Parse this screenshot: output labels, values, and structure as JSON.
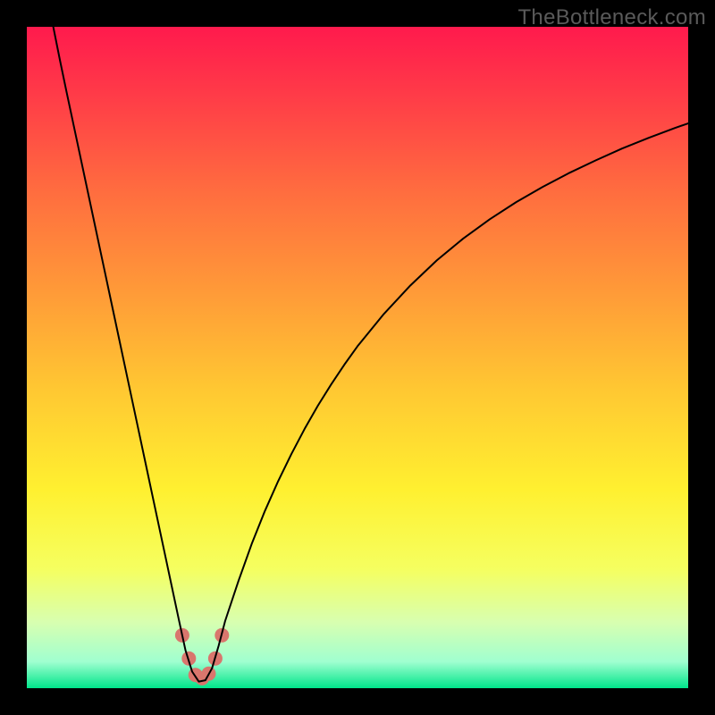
{
  "watermark_text": "TheBottleneck.com",
  "chart_data": {
    "type": "line",
    "title": "",
    "xlabel": "",
    "ylabel": "",
    "xlim": [
      0,
      100
    ],
    "ylim": [
      0,
      100
    ],
    "grid": false,
    "legend": false,
    "background_gradient_stops": [
      {
        "offset": 0.0,
        "color": "#ff1a4d"
      },
      {
        "offset": 0.1,
        "color": "#ff3a48"
      },
      {
        "offset": 0.25,
        "color": "#ff6d3f"
      },
      {
        "offset": 0.4,
        "color": "#ff9a38"
      },
      {
        "offset": 0.55,
        "color": "#ffc832"
      },
      {
        "offset": 0.7,
        "color": "#fff030"
      },
      {
        "offset": 0.82,
        "color": "#f5ff60"
      },
      {
        "offset": 0.9,
        "color": "#d8ffb0"
      },
      {
        "offset": 0.96,
        "color": "#a0ffd0"
      },
      {
        "offset": 1.0,
        "color": "#00e58a"
      }
    ],
    "series": [
      {
        "name": "bottleneck-curve",
        "color": "#000000",
        "stroke_width": 2.0,
        "x": [
          4.0,
          5.0,
          6.0,
          7.0,
          8.0,
          9.0,
          10.0,
          11.0,
          12.0,
          13.0,
          14.0,
          15.0,
          16.0,
          17.0,
          18.0,
          19.0,
          20.0,
          21.0,
          22.0,
          23.0,
          24.0,
          25.0,
          26.0,
          27.0,
          28.0,
          29.0,
          30.0,
          32.0,
          34.0,
          36.0,
          38.0,
          40.0,
          42.0,
          44.0,
          46.0,
          48.0,
          50.0,
          54.0,
          58.0,
          62.0,
          66.0,
          70.0,
          74.0,
          78.0,
          82.0,
          86.0,
          90.0,
          94.0,
          98.0,
          100.0
        ],
        "y": [
          100.0,
          95.0,
          90.2,
          85.5,
          80.8,
          76.1,
          71.4,
          66.7,
          62.0,
          57.3,
          52.6,
          47.9,
          43.2,
          38.5,
          33.8,
          29.1,
          24.4,
          19.7,
          15.0,
          10.3,
          5.7,
          2.5,
          1.0,
          1.2,
          3.0,
          6.4,
          10.2,
          16.2,
          21.8,
          26.8,
          31.3,
          35.4,
          39.2,
          42.7,
          45.9,
          48.9,
          51.7,
          56.6,
          60.9,
          64.7,
          68.0,
          70.9,
          73.5,
          75.8,
          77.9,
          79.8,
          81.6,
          83.2,
          84.7,
          85.4
        ]
      }
    ],
    "markers": [
      {
        "name": "min-highlight",
        "color": "#d9766d",
        "radius": 8,
        "points": [
          {
            "x": 23.5,
            "y": 8.0
          },
          {
            "x": 24.5,
            "y": 4.5
          },
          {
            "x": 25.5,
            "y": 2.0
          },
          {
            "x": 26.5,
            "y": 1.5
          },
          {
            "x": 27.5,
            "y": 2.2
          },
          {
            "x": 28.5,
            "y": 4.5
          },
          {
            "x": 29.5,
            "y": 8.0
          }
        ]
      }
    ]
  }
}
